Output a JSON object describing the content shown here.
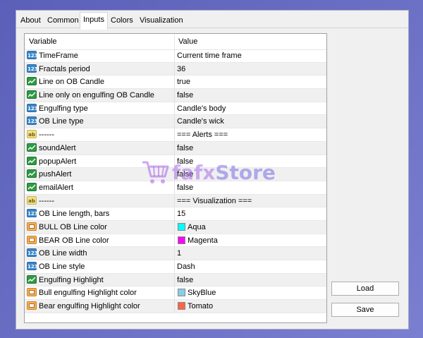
{
  "tabs": [
    "About",
    "Common",
    "Inputs",
    "Colors",
    "Visualization"
  ],
  "active_tab": "Inputs",
  "table": {
    "col_variable": "Variable",
    "col_value": "Value",
    "rows": [
      {
        "type": "num",
        "name": "TimeFrame",
        "value": "Current time frame"
      },
      {
        "type": "num",
        "name": "Fractals period",
        "value": "36"
      },
      {
        "type": "bool",
        "name": "Line on OB Candle",
        "value": "true"
      },
      {
        "type": "bool",
        "name": "Line only on engulfing OB Candle",
        "value": "false"
      },
      {
        "type": "num",
        "name": "Engulfing type",
        "value": "Candle's body"
      },
      {
        "type": "num",
        "name": "OB Line type",
        "value": "Candle's wick"
      },
      {
        "type": "str",
        "name": "------",
        "value": "=== Alerts ==="
      },
      {
        "type": "bool",
        "name": "soundAlert",
        "value": "false"
      },
      {
        "type": "bool",
        "name": "popupAlert",
        "value": "false"
      },
      {
        "type": "bool",
        "name": "pushAlert",
        "value": "false"
      },
      {
        "type": "bool",
        "name": "emailAlert",
        "value": "false"
      },
      {
        "type": "str",
        "name": "------",
        "value": "=== Visualization ==="
      },
      {
        "type": "num",
        "name": "OB Line length, bars",
        "value": "15"
      },
      {
        "type": "clr",
        "name": "BULL OB Line color",
        "value": "Aqua",
        "color": "#00ffff"
      },
      {
        "type": "clr",
        "name": "BEAR OB Line color",
        "value": "Magenta",
        "color": "#ff00ff"
      },
      {
        "type": "num",
        "name": "OB Line width",
        "value": "1"
      },
      {
        "type": "num",
        "name": "OB Line style",
        "value": "Dash"
      },
      {
        "type": "bool",
        "name": "Engulfing Highlight",
        "value": "false"
      },
      {
        "type": "clr",
        "name": "Bull engulfing Highlight color",
        "value": "SkyBlue",
        "color": "#87ceeb"
      },
      {
        "type": "clr",
        "name": "Bear engulfing Highlight color",
        "value": "Tomato",
        "color": "#ff6347"
      }
    ]
  },
  "buttons": {
    "load": "Load",
    "save": "Save"
  },
  "watermark": {
    "part1": "fafx",
    "part2": "Store"
  },
  "icon_labels": {
    "num": "123",
    "bool": "",
    "str": "ab"
  }
}
